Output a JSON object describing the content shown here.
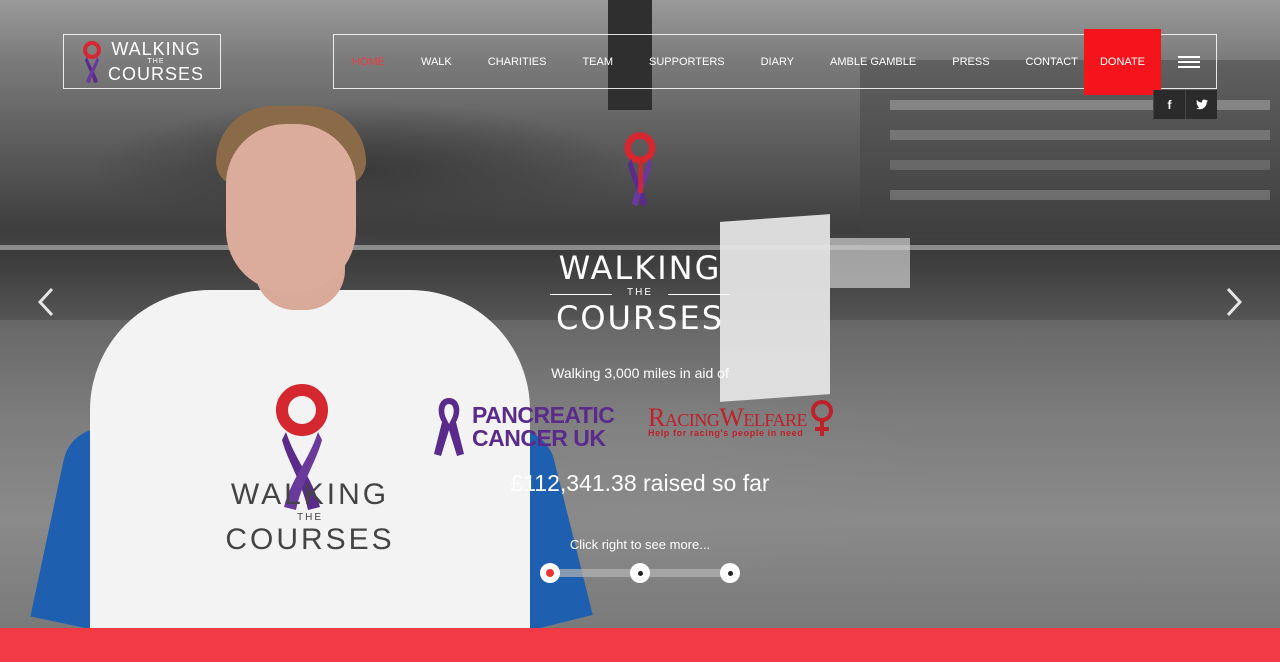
{
  "brand": {
    "logo_word_top": "WALKING",
    "logo_word_mid": "THE",
    "logo_word_bottom": "COURSES"
  },
  "nav": {
    "items": [
      {
        "label": "HOME",
        "active": true
      },
      {
        "label": "WALK"
      },
      {
        "label": "CHARITIES"
      },
      {
        "label": "TEAM"
      },
      {
        "label": "SUPPORTERS"
      },
      {
        "label": "DIARY"
      },
      {
        "label": "AMBLE GAMBLE"
      },
      {
        "label": "PRESS"
      },
      {
        "label": "CONTACT"
      }
    ],
    "donate_label": "DONATE",
    "menu_icon": "hamburger-icon"
  },
  "social": {
    "facebook": "f",
    "twitter_icon": "twitter-icon"
  },
  "hero": {
    "logo_word_top": "WALKING",
    "logo_word_mid": "THE",
    "logo_word_bottom": "COURSES",
    "aid_text": "Walking 3,000 miles in aid of",
    "charity_1_line1": "PANCREATIC",
    "charity_1_line2": "CANCER UK",
    "charity_2_name": "RacingWelfare",
    "charity_2_tagline": "Help for racing's people in need",
    "raised_text": "£112,341.38 raised so far",
    "click_more_text": "Click right to see more...",
    "slide_count": 3,
    "active_slide": 1,
    "shirt_word_top": "WALKING",
    "shirt_word_mid": "THE",
    "shirt_word_bottom": "COURSES"
  },
  "colors": {
    "accent_red": "#f5131c",
    "active_nav": "#ef3a43",
    "bottom_bar": "#f23a46",
    "ribbon_purple": "#5a2b8a",
    "ribbon_red": "#d4272f"
  }
}
